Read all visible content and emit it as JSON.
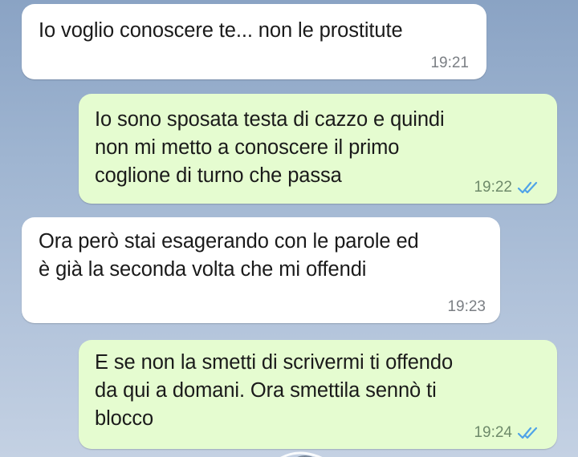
{
  "chat": {
    "messages": [
      {
        "direction": "incoming",
        "text": "Io voglio conoscere te... non le prostitute",
        "time": "19:21"
      },
      {
        "direction": "outgoing",
        "text": "Io sono sposata testa di cazzo e quindi\nnon mi metto a conoscere il primo\ncoglione di turno che passa",
        "time": "19:22",
        "status_icon": "double-check-read-icon"
      },
      {
        "direction": "incoming",
        "text": "Ora però stai esagerando con le parole ed\nè già la seconda volta che mi offendi",
        "time": "19:23"
      },
      {
        "direction": "outgoing",
        "text": "E se non la smetti di scrivermi ti offendo\nda qui a domani. Ora smettila sennò ti\nblocco",
        "time": "19:24",
        "status_icon": "double-check-read-icon"
      }
    ]
  },
  "colors": {
    "incoming_bubble": "#ffffff",
    "outgoing_bubble": "#e5fcd0",
    "read_ticks": "#4fa3e8",
    "wallpaper": "#9fb5d1"
  }
}
